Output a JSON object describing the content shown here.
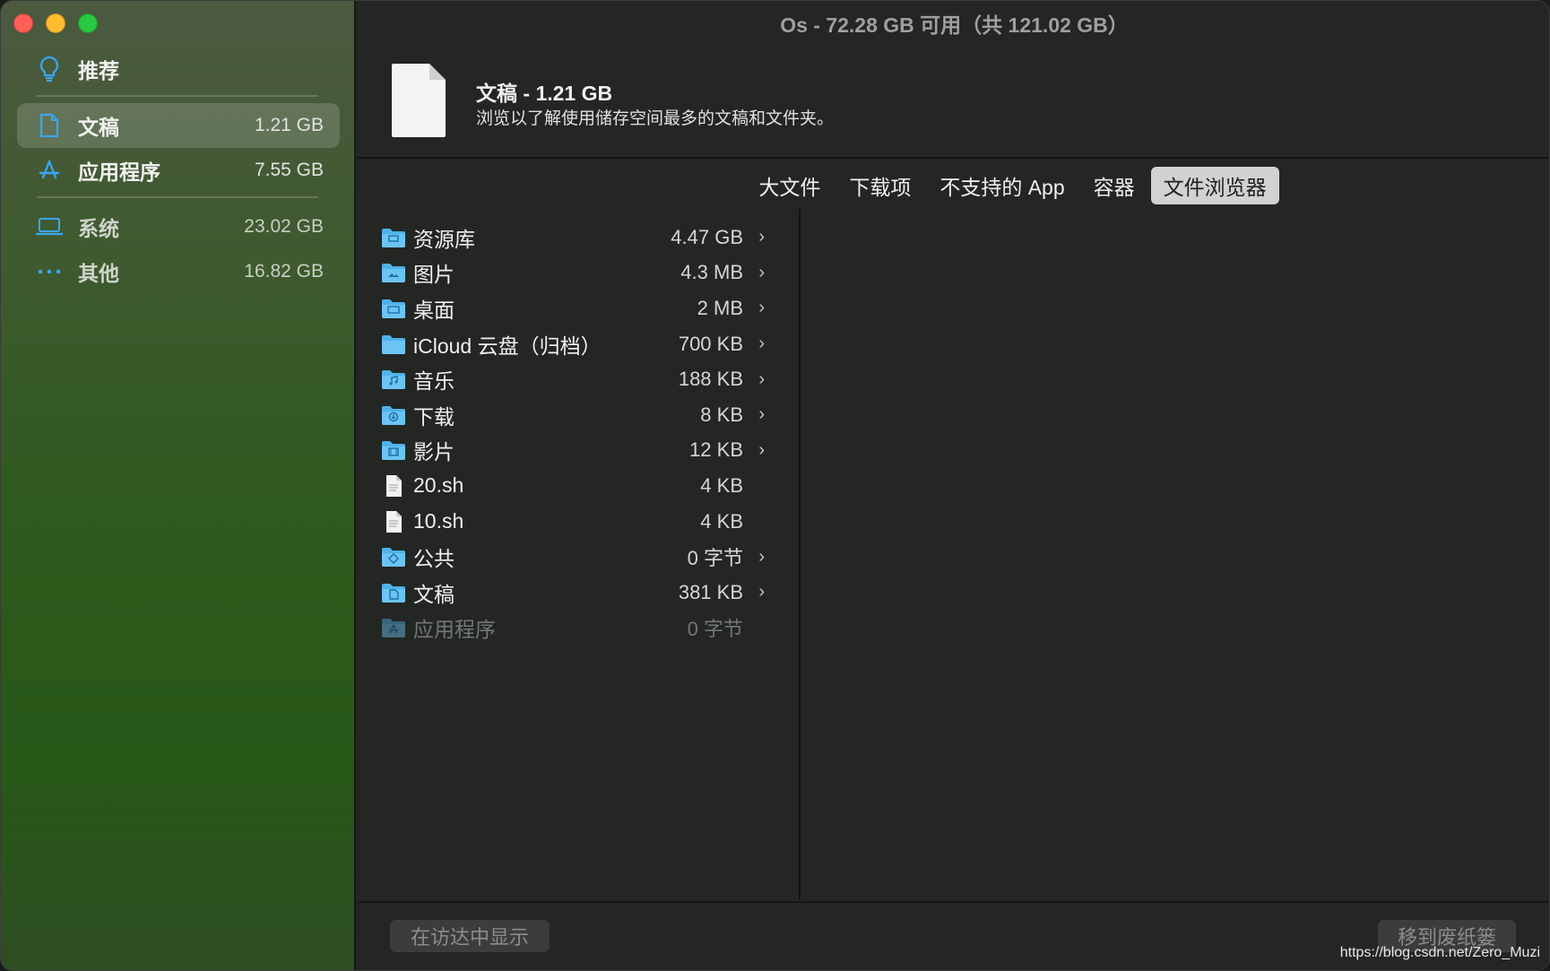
{
  "window": {
    "title": "Os - 72.28 GB 可用（共 121.02 GB）"
  },
  "sidebar": {
    "items": [
      {
        "label": "推荐",
        "size": "",
        "icon": "lightbulb-icon"
      },
      {
        "label": "文稿",
        "size": "1.21 GB",
        "icon": "document-icon",
        "selected": true
      },
      {
        "label": "应用程序",
        "size": "7.55 GB",
        "icon": "app-store-icon"
      },
      {
        "label": "系统",
        "size": "23.02 GB",
        "icon": "laptop-icon"
      },
      {
        "label": "其他",
        "size": "16.82 GB",
        "icon": "ellipsis-icon"
      }
    ]
  },
  "header": {
    "title": "文稿 - 1.21 GB",
    "description": "浏览以了解使用储存空间最多的文稿和文件夹。"
  },
  "tabs": [
    "大文件",
    "下载项",
    "不支持的 App",
    "容器",
    "文件浏览器"
  ],
  "active_tab": "文件浏览器",
  "files": [
    {
      "name": "资源库",
      "size": "4.47 GB",
      "type": "folder",
      "icon": "library-folder-icon",
      "chevron": true
    },
    {
      "name": "图片",
      "size": "4.3 MB",
      "type": "folder",
      "icon": "pictures-folder-icon",
      "chevron": true
    },
    {
      "name": "桌面",
      "size": "2 MB",
      "type": "folder",
      "icon": "desktop-folder-icon",
      "chevron": true
    },
    {
      "name": "iCloud 云盘（归档）",
      "size": "700 KB",
      "type": "folder",
      "icon": "folder-icon",
      "chevron": true
    },
    {
      "name": "音乐",
      "size": "188 KB",
      "type": "folder",
      "icon": "music-folder-icon",
      "chevron": true
    },
    {
      "name": "下载",
      "size": "8 KB",
      "type": "folder",
      "icon": "downloads-folder-icon",
      "chevron": true
    },
    {
      "name": "影片",
      "size": "12 KB",
      "type": "folder",
      "icon": "movies-folder-icon",
      "chevron": true
    },
    {
      "name": "20.sh",
      "size": "4 KB",
      "type": "file",
      "icon": "file-icon",
      "chevron": false
    },
    {
      "name": "10.sh",
      "size": "4 KB",
      "type": "file",
      "icon": "file-icon",
      "chevron": false
    },
    {
      "name": "公共",
      "size": "0 字节",
      "type": "folder",
      "icon": "public-folder-icon",
      "chevron": true
    },
    {
      "name": "文稿",
      "size": "381 KB",
      "type": "folder",
      "icon": "documents-folder-icon",
      "chevron": true
    },
    {
      "name": "应用程序",
      "size": "0 字节",
      "type": "folder",
      "icon": "applications-folder-icon",
      "chevron": false,
      "disabled": true
    }
  ],
  "footer": {
    "show_in_finder": "在访达中显示",
    "move_to_trash": "移到废纸篓"
  },
  "watermark": "https://blog.csdn.net/Zero_Muzi",
  "colors": {
    "accent": "#3aa6f0",
    "folder": "#4fb2ea"
  }
}
